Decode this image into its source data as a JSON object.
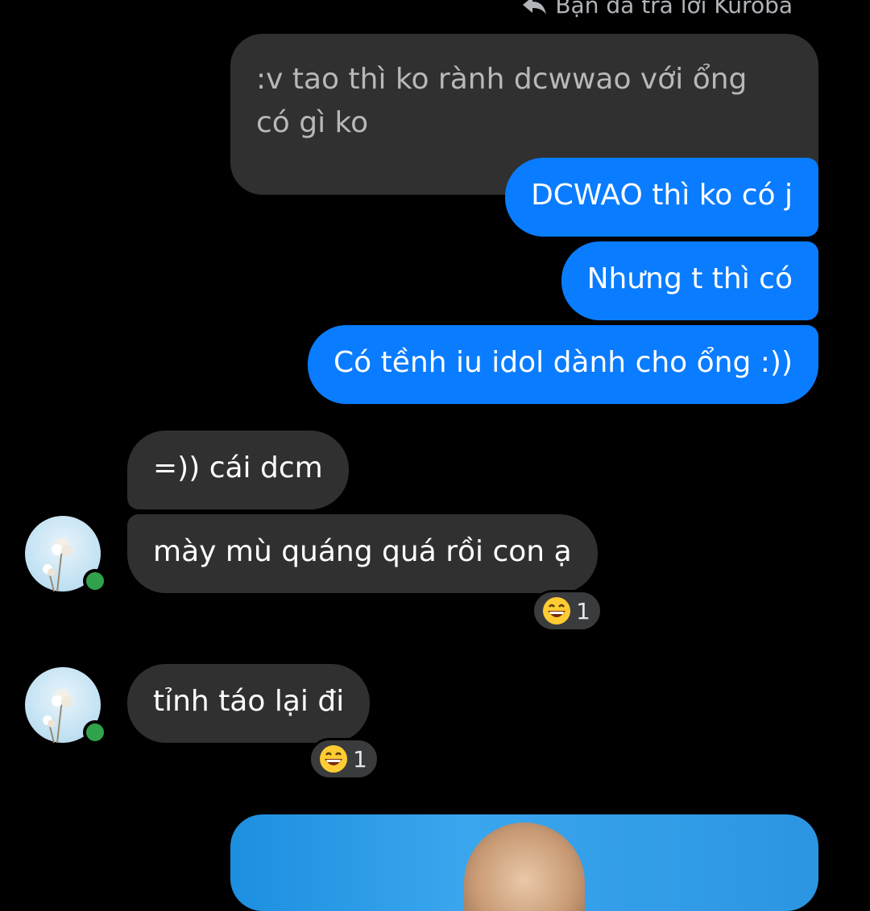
{
  "reply_context": {
    "text": "Bạn đã trả lời Kuroba",
    "icon": "reply-arrow-icon"
  },
  "quoted_message": {
    "text": ":v tao thì ko rành dcwwao với ổng có gì ko"
  },
  "outgoing_messages": [
    {
      "text": "DCWAO thì ko có j"
    },
    {
      "text": "Nhưng t thì có"
    },
    {
      "text": "Có tềnh iu idol dành cho ổng :))"
    }
  ],
  "incoming_messages": [
    {
      "text": "=)) cái dcm"
    },
    {
      "text": "mày mù quáng quá rồi con ạ",
      "reaction": {
        "emoji": "grinning-face-icon",
        "count": "1"
      }
    },
    {
      "text": "tỉnh táo lại đi",
      "reaction": {
        "emoji": "grinning-face-icon",
        "count": "1"
      }
    }
  ],
  "colors": {
    "background": "#000000",
    "outgoing_bubble": "#0a7cff",
    "incoming_bubble": "#303030",
    "online_indicator": "#31a24c"
  }
}
